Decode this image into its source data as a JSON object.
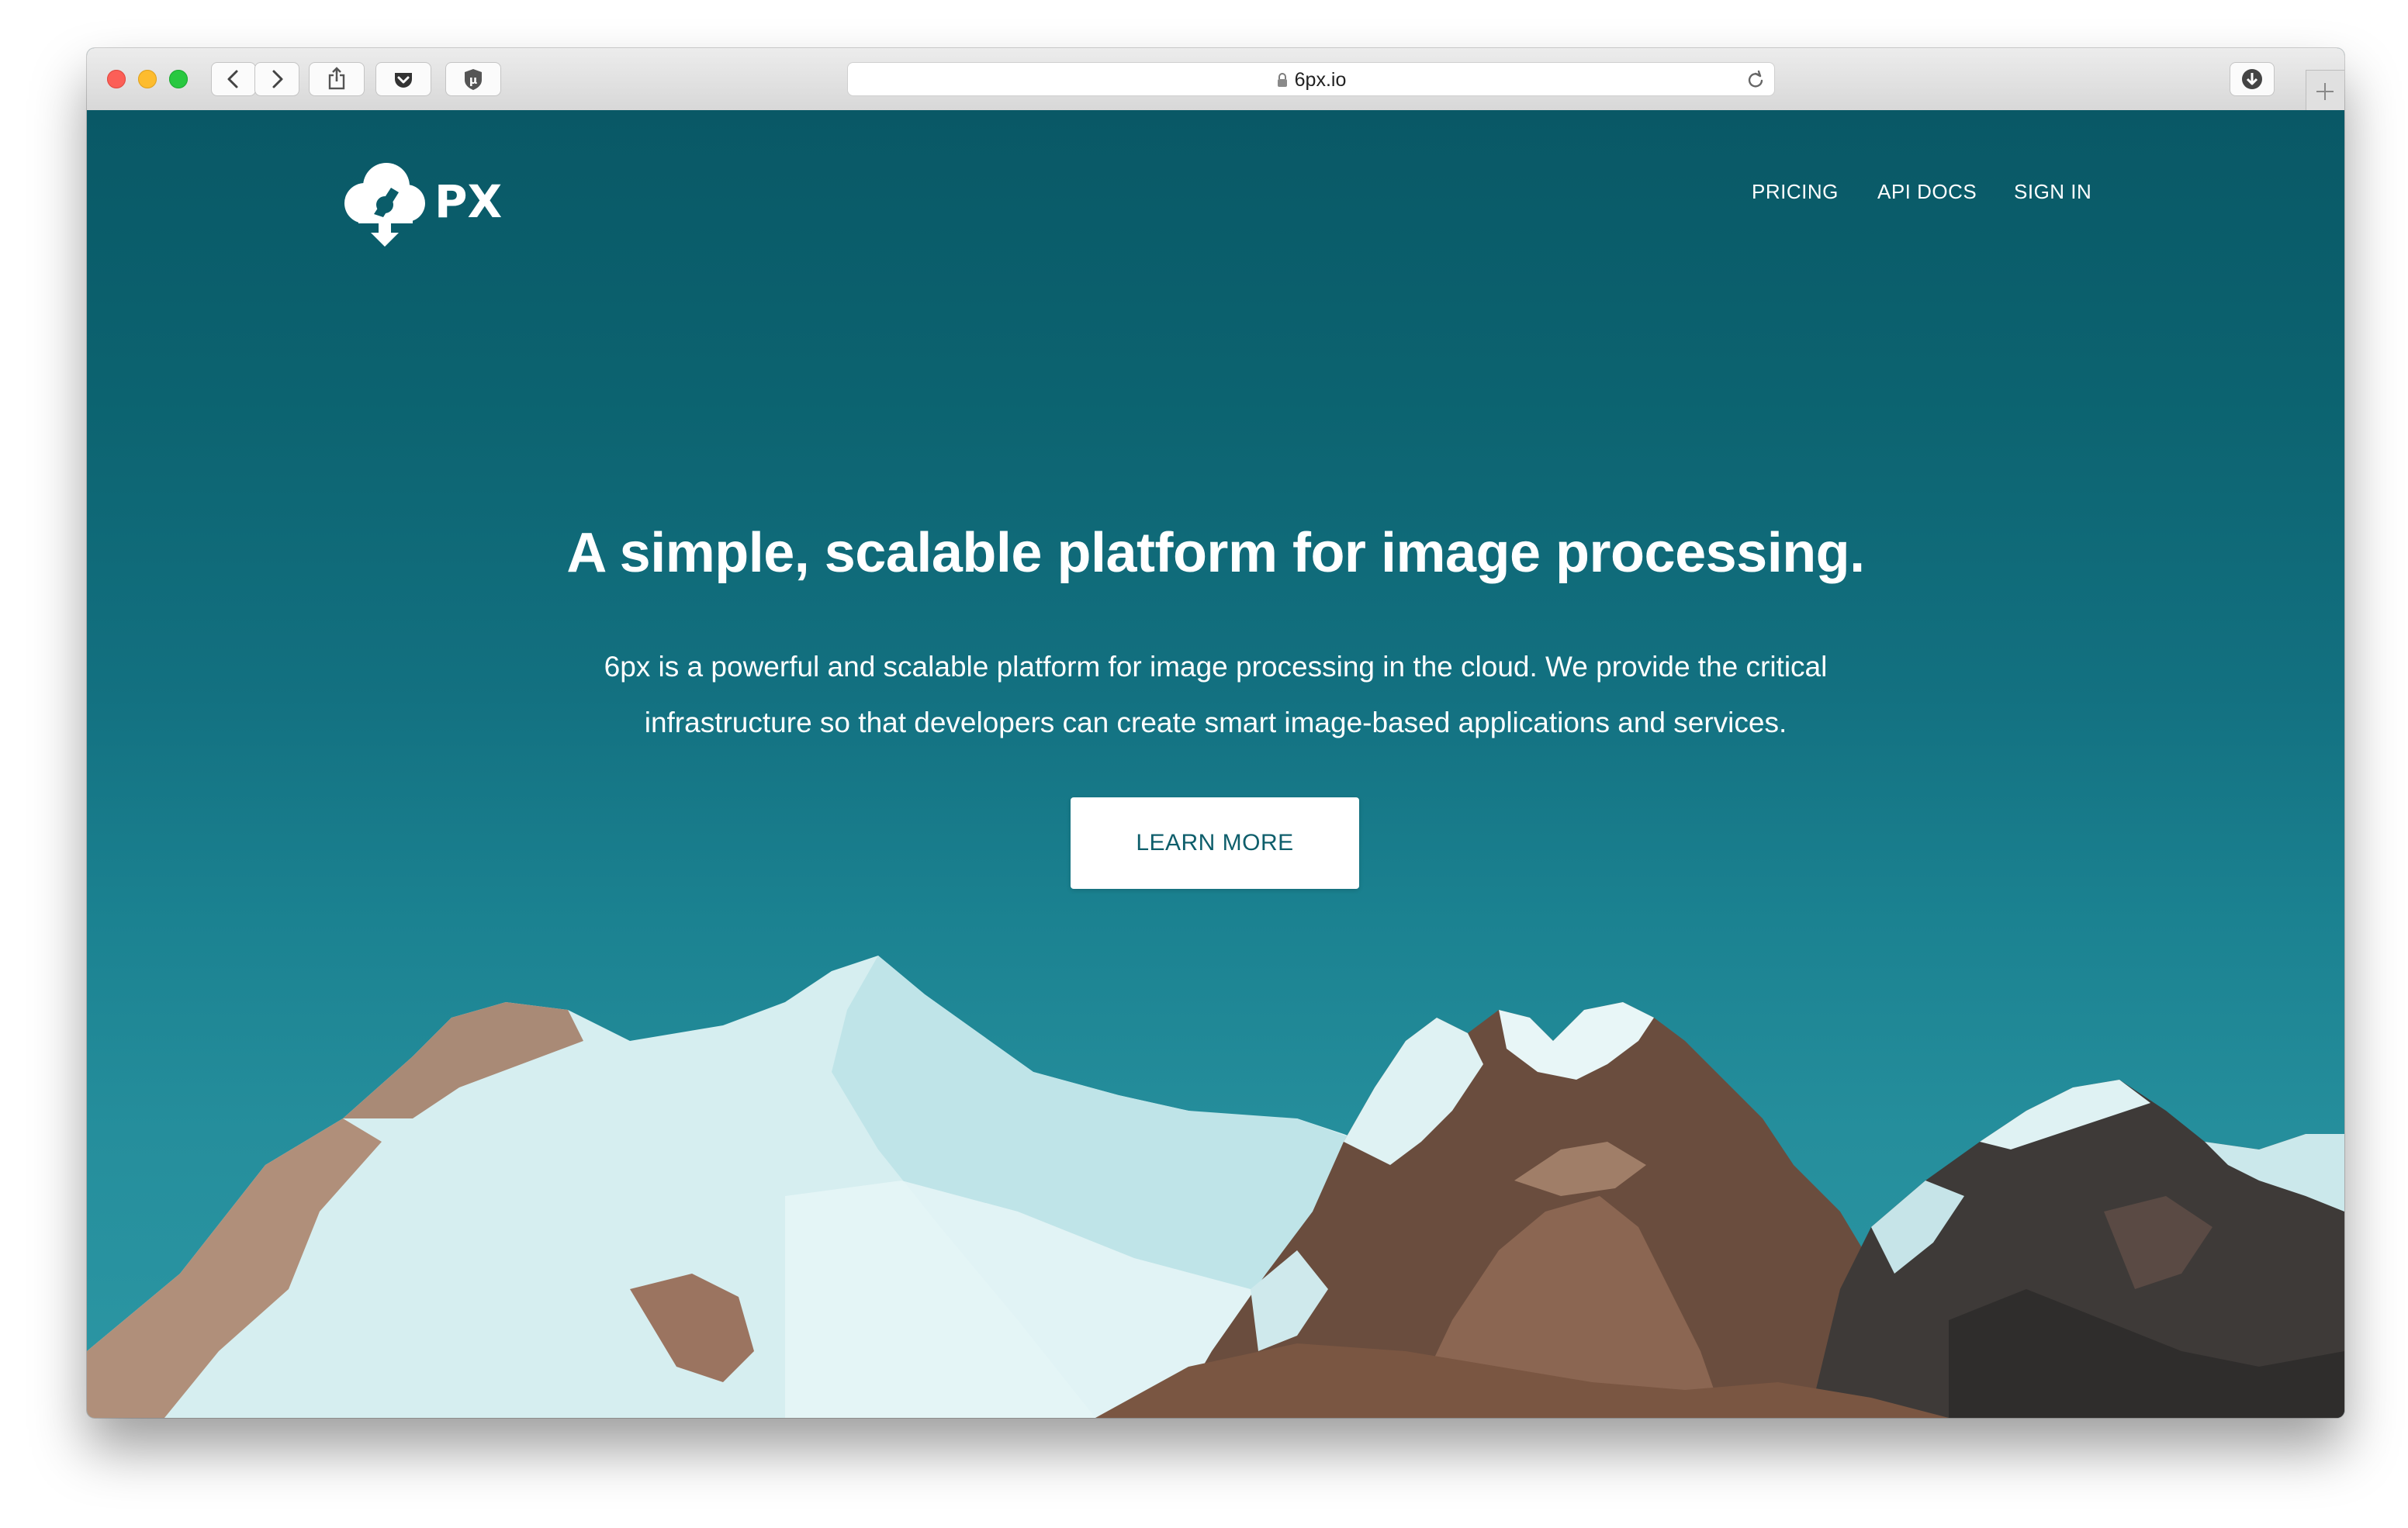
{
  "browser": {
    "url": "6px.io",
    "icons": {
      "back": "chevron-left-icon",
      "forward": "chevron-right-icon",
      "share": "share-icon",
      "pocket": "pocket-icon",
      "extension": "ublock-icon",
      "lock": "lock-icon",
      "reload": "reload-icon",
      "downloads": "download-icon",
      "new_tab": "plus-icon"
    }
  },
  "site": {
    "logo_text": "PX",
    "nav": [
      {
        "label": "PRICING"
      },
      {
        "label": "API DOCS"
      },
      {
        "label": "SIGN IN"
      }
    ],
    "hero": {
      "title": "A simple, scalable platform for image processing.",
      "subtitle_line1": "6px is a powerful and scalable platform for image processing in the cloud. We provide the critical",
      "subtitle_line2": "infrastructure so that developers can create smart image-based applications and services.",
      "cta_label": "LEARN MORE"
    }
  },
  "colors": {
    "accent": "#0e5e6b",
    "background_top": "#095866",
    "background_bottom": "#2c97a4",
    "text": "#ffffff"
  }
}
